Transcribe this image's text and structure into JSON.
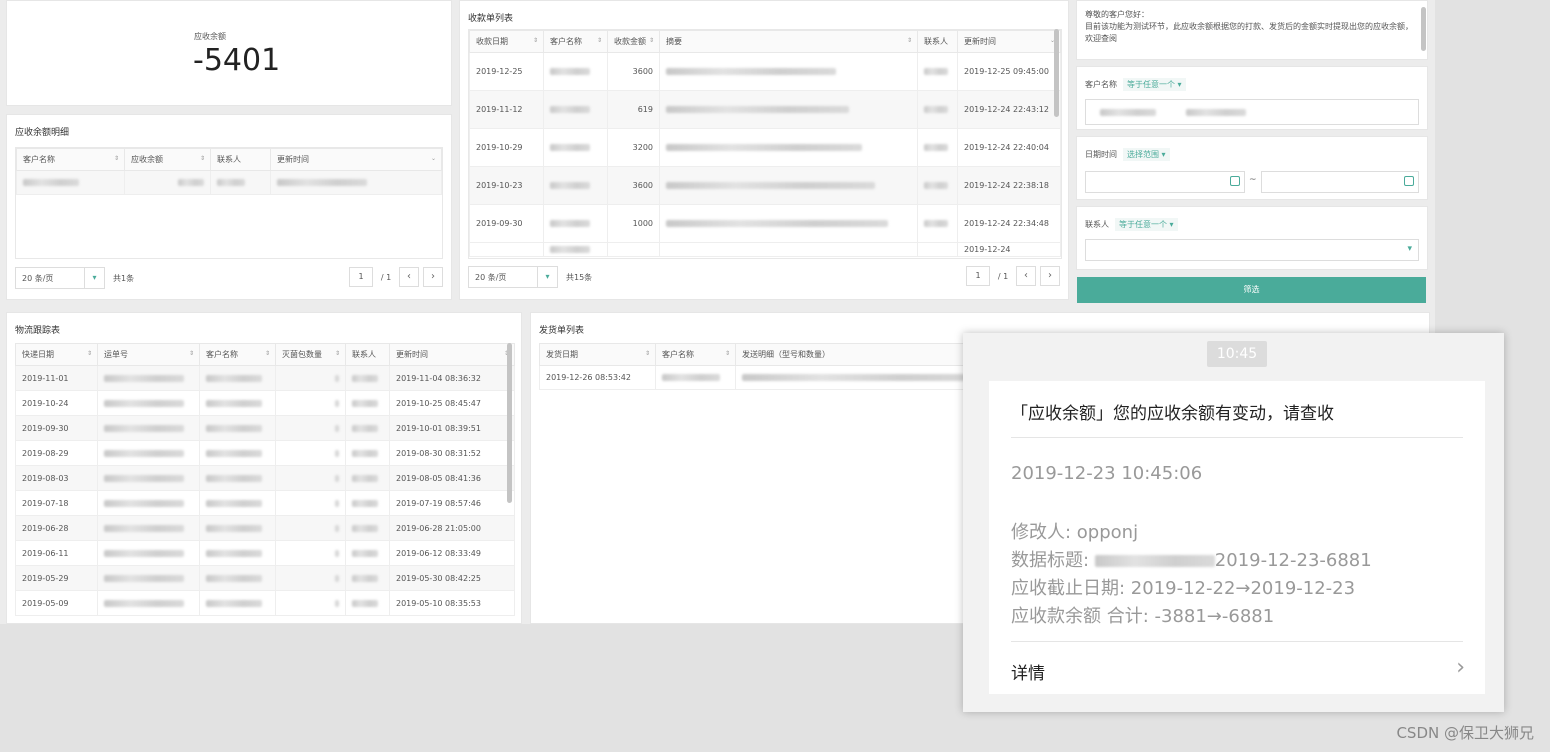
{
  "balance_card": {
    "label": "应收余额",
    "value": "-5401"
  },
  "detail_card": {
    "title": "应收余额明细",
    "columns": [
      "客户名称",
      "应收余额",
      "联系人",
      "更新时间"
    ],
    "page_size": "20 条/页",
    "total": "共1条",
    "page": "1",
    "page_total": "/ 1"
  },
  "receipts_card": {
    "title": "收款单列表",
    "columns": [
      "收款日期",
      "客户名称",
      "收款金额",
      "摘要",
      "联系人",
      "更新时间"
    ],
    "rows": [
      {
        "date": "2019-12-25",
        "amount": "3600",
        "updated": "2019-12-25 09:45:00"
      },
      {
        "date": "2019-11-12",
        "amount": "619",
        "updated": "2019-12-24 22:43:12"
      },
      {
        "date": "2019-10-29",
        "amount": "3200",
        "updated": "2019-12-24 22:40:04"
      },
      {
        "date": "2019-10-23",
        "amount": "3600",
        "updated": "2019-12-24 22:38:18"
      },
      {
        "date": "2019-09-30",
        "amount": "1000",
        "updated": "2019-12-24 22:34:48"
      }
    ],
    "partial_row_updated": "2019-12-24",
    "page_size": "20 条/页",
    "total": "共15条",
    "page": "1",
    "page_total": "/ 1"
  },
  "filter_panel": {
    "notice": "尊敬的客户您好：\n目前该功能为测试环节，此应收余额根据您的打款、发货后的金额实时提现出您的应收余额，欢迎查阅",
    "customer_label": "客户名称",
    "customer_op": "等于任意一个 ▾",
    "date_label": "日期时间",
    "date_op": "选择范围 ▾",
    "date_sep": "~",
    "contact_label": "联系人",
    "contact_op": "等于任意一个 ▾",
    "submit_label": "筛选"
  },
  "logistics_card": {
    "title": "物流跟踪表",
    "columns": [
      "快递日期",
      "运单号",
      "客户名称",
      "灭菌包数量",
      "联系人",
      "更新时间"
    ],
    "rows": [
      {
        "date": "2019-11-01",
        "updated": "2019-11-04 08:36:32"
      },
      {
        "date": "2019-10-24",
        "updated": "2019-10-25 08:45:47"
      },
      {
        "date": "2019-09-30",
        "updated": "2019-10-01 08:39:51"
      },
      {
        "date": "2019-08-29",
        "updated": "2019-08-30 08:31:52"
      },
      {
        "date": "2019-08-03",
        "updated": "2019-08-05 08:41:36"
      },
      {
        "date": "2019-07-18",
        "updated": "2019-07-19 08:57:46"
      },
      {
        "date": "2019-06-28",
        "updated": "2019-06-28 21:05:00"
      },
      {
        "date": "2019-06-11",
        "updated": "2019-06-12 08:33:49"
      },
      {
        "date": "2019-05-29",
        "updated": "2019-05-30 08:42:25"
      },
      {
        "date": "2019-05-09",
        "updated": "2019-05-10 08:35:53"
      }
    ]
  },
  "shipping_card": {
    "title": "发货单列表",
    "columns": [
      "发货日期",
      "客户名称",
      "发送明细（型号和数量）"
    ],
    "rows": [
      {
        "date": "2019-12-26 08:53:42"
      }
    ]
  },
  "notification": {
    "time": "10:45",
    "title": "「应收余额」您的应收余额有变动，请查收",
    "date": "2019-12-23 10:45:06",
    "modifier": "修改人: opponj",
    "data_title_prefix": "数据标题: ",
    "data_title_suffix": "2019-12-23-6881",
    "due_date": "应收截止日期: 2019-12-22→2019-12-23",
    "amount": "应收款余额 合计: -3881→-6881",
    "detail_label": "详情"
  },
  "watermark": "CSDN @保卫大狮兄",
  "colors": {
    "accent": "#4aab9a",
    "background": "#e2e2e2"
  }
}
